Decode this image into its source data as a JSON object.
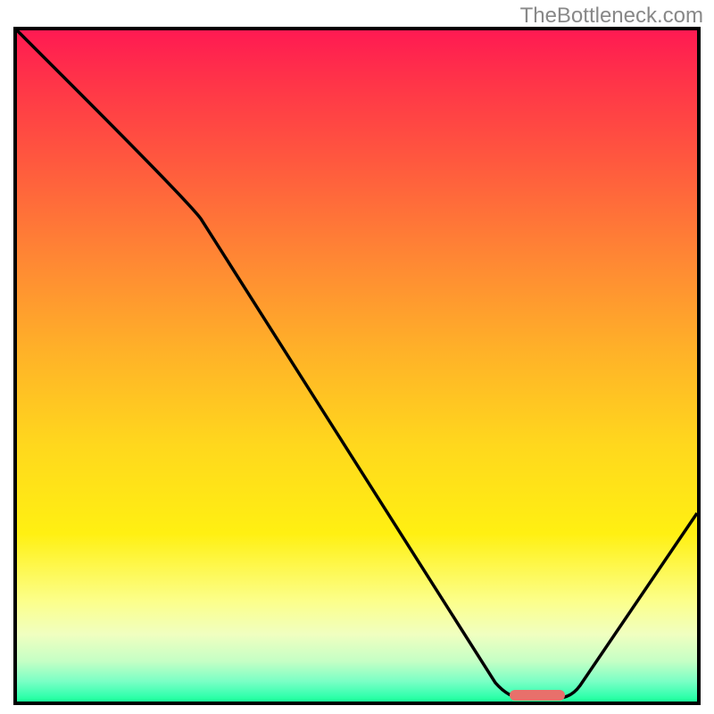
{
  "watermark": "TheBottleneck.com",
  "chart_data": {
    "type": "line",
    "title": "",
    "xlabel": "",
    "ylabel": "",
    "xlim": [
      0,
      100
    ],
    "ylim": [
      0,
      100
    ],
    "description": "Bottleneck curve showing performance deviation across a parameter range. Color gradient background from red (high bottleneck) at top to green (optimal) at bottom. V-shaped curve with minimum around x=75.",
    "series": [
      {
        "name": "bottleneck-curve",
        "x": [
          0,
          25,
          70,
          73,
          79,
          82,
          100
        ],
        "y": [
          100,
          75,
          3,
          0,
          0,
          3,
          28
        ]
      }
    ],
    "marker": {
      "x_start": 72,
      "x_end": 80,
      "y": 0.5,
      "color": "#e8706b",
      "label": "optimal-range"
    },
    "gradient_colors": {
      "top": "#ff1a52",
      "upper_mid": "#ffb228",
      "lower_mid": "#fff012",
      "bottom": "#1aff9a"
    }
  }
}
